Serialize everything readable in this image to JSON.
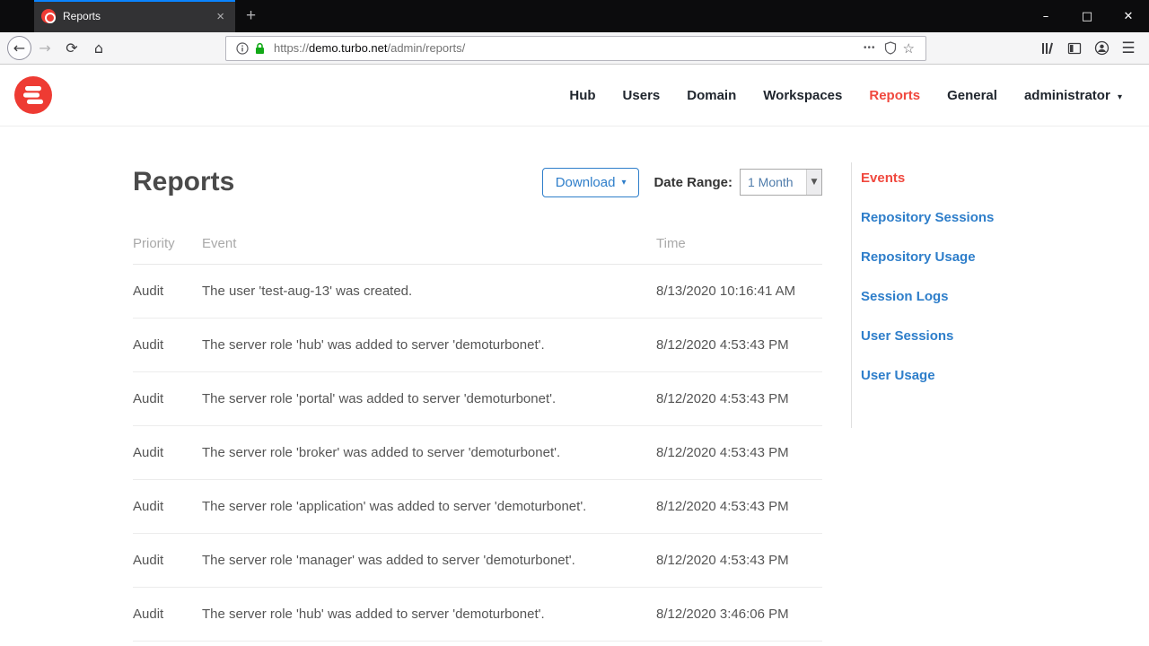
{
  "browser": {
    "tab_title": "Reports",
    "url_scheme": "https://",
    "url_domain": "demo.turbo.net",
    "url_path": "/admin/reports/"
  },
  "icons": {
    "back": "←",
    "forward": "→",
    "reload": "⟳",
    "home": "⌂",
    "ellipsis": "•••",
    "star": "☆",
    "new_tab": "+",
    "tab_close": "×",
    "minimize": "–",
    "maximize": "□",
    "close": "✕",
    "hamburger": "☰",
    "caret_down": "▾",
    "select_caret": "▼"
  },
  "site_nav": {
    "items": [
      {
        "label": "Hub"
      },
      {
        "label": "Users"
      },
      {
        "label": "Domain"
      },
      {
        "label": "Workspaces"
      },
      {
        "label": "Reports"
      },
      {
        "label": "General"
      }
    ],
    "user_menu": "administrator"
  },
  "page": {
    "title": "Reports",
    "download_label": "Download",
    "date_range_label": "Date Range:",
    "date_range_value": "1 Month"
  },
  "sidebar": {
    "items": [
      {
        "label": "Events"
      },
      {
        "label": "Repository Sessions"
      },
      {
        "label": "Repository Usage"
      },
      {
        "label": "Session Logs"
      },
      {
        "label": "User Sessions"
      },
      {
        "label": "User Usage"
      }
    ]
  },
  "table": {
    "headers": [
      "Priority",
      "Event",
      "Time"
    ],
    "rows": [
      {
        "priority": "Audit",
        "event": "The user 'test-aug-13' was created.",
        "time": "8/13/2020 10:16:41 AM"
      },
      {
        "priority": "Audit",
        "event": "The server role 'hub' was added to server 'demoturbonet'.",
        "time": "8/12/2020 4:53:43 PM"
      },
      {
        "priority": "Audit",
        "event": "The server role 'portal' was added to server 'demoturbonet'.",
        "time": "8/12/2020 4:53:43 PM"
      },
      {
        "priority": "Audit",
        "event": "The server role 'broker' was added to server 'demoturbonet'.",
        "time": "8/12/2020 4:53:43 PM"
      },
      {
        "priority": "Audit",
        "event": "The server role 'application' was added to server 'demoturbonet'.",
        "time": "8/12/2020 4:53:43 PM"
      },
      {
        "priority": "Audit",
        "event": "The server role 'manager' was added to server 'demoturbonet'.",
        "time": "8/12/2020 4:53:43 PM"
      },
      {
        "priority": "Audit",
        "event": "The server role 'hub' was added to server 'demoturbonet'.",
        "time": "8/12/2020 3:46:06 PM"
      }
    ]
  },
  "colors": {
    "brand_red": "#ee3b33",
    "link_blue": "#2e7eca",
    "active_red": "#f0483e",
    "lock_green": "#12a917"
  }
}
